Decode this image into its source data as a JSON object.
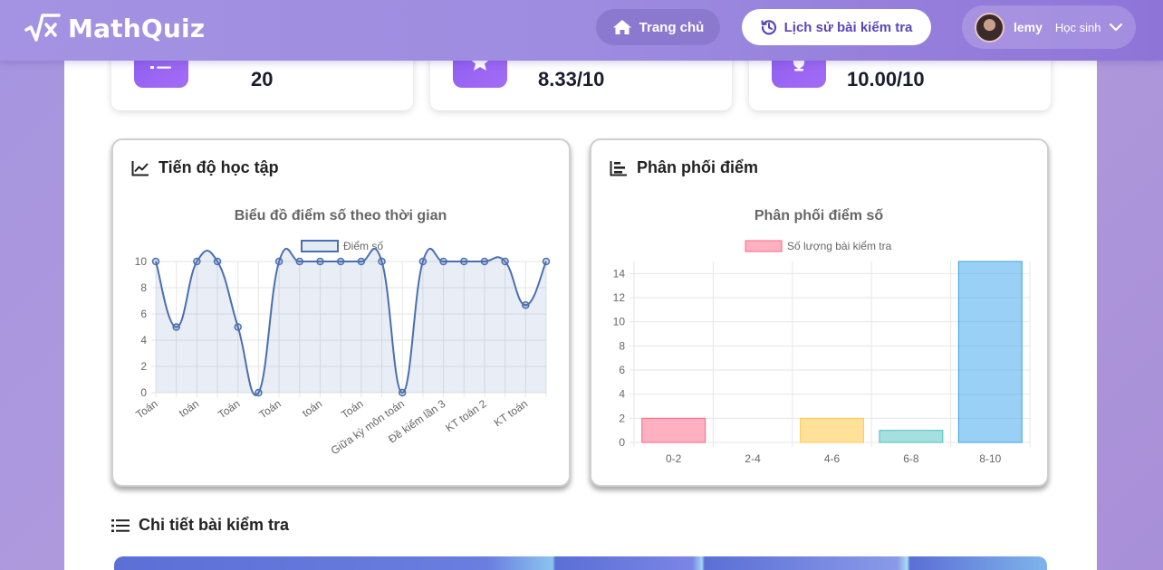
{
  "navbar": {
    "brand": "MathQuiz",
    "home_label": "Trang chủ",
    "history_label": "Lịch sử bài kiểm tra",
    "user_name": "lemy",
    "user_role": "Học sinh"
  },
  "stats": [
    {
      "value": "20",
      "icon": "list-icon"
    },
    {
      "value": "8.33/10",
      "icon": "star-icon"
    },
    {
      "value": "10.00/10",
      "icon": "trophy-icon"
    }
  ],
  "progress_card": {
    "title": "Tiến độ học tập"
  },
  "distribution_card": {
    "title": "Phân phối điểm"
  },
  "details": {
    "title": "Chi tiết bài kiểm tra"
  },
  "colors": {
    "accent": "#7c5cf0",
    "line": "#4a6fb0",
    "bar_pink": "#ffb1c1",
    "bar_yellow": "#ffe6a4",
    "bar_teal": "#a5e0e0",
    "bar_blue": "#9ad0f5"
  },
  "chart_data": [
    {
      "type": "line",
      "title": "Biểu đồ điểm số theo thời gian",
      "series": [
        {
          "name": "Điểm số",
          "values": [
            10,
            5,
            10,
            10,
            5,
            0,
            10,
            10,
            10,
            10,
            10,
            10,
            0,
            10,
            10,
            10,
            10,
            10,
            6.67,
            10
          ]
        }
      ],
      "categories": [
        "Toán",
        "",
        "toán",
        "",
        "Toán",
        "",
        "Toán",
        "",
        "toán",
        "",
        "Toán",
        "",
        "Giữa kỳ môn toán",
        "",
        "Đề kiểm lần 3",
        "",
        "KT toán 2",
        "",
        "KT toán",
        ""
      ],
      "ylim": [
        0,
        10
      ],
      "yticks": [
        0,
        2,
        4,
        6,
        8,
        10
      ],
      "grid": true,
      "legend": "top"
    },
    {
      "type": "bar",
      "title": "Phân phối điểm số",
      "categories": [
        "0-2",
        "2-4",
        "4-6",
        "6-8",
        "8-10"
      ],
      "series": [
        {
          "name": "Số lượng bài kiểm tra",
          "values": [
            2,
            0,
            2,
            1,
            15
          ]
        }
      ],
      "ylim": [
        0,
        15
      ],
      "yticks": [
        0,
        2,
        4,
        6,
        8,
        10,
        12,
        14
      ],
      "grid": true,
      "legend": "top"
    }
  ]
}
